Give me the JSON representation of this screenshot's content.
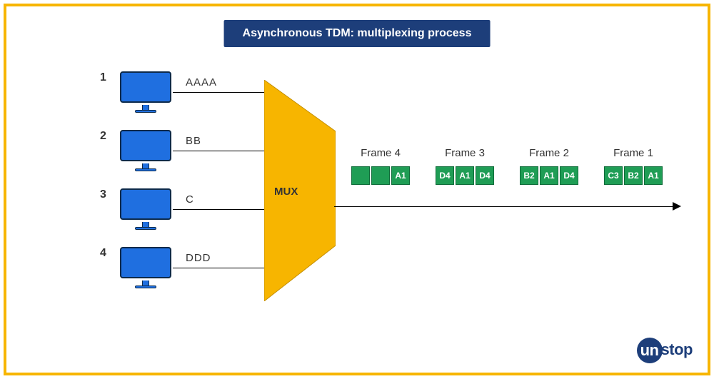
{
  "title": "Asynchronous TDM: multiplexing process",
  "inputs": [
    {
      "num": "1",
      "data": "AAAA"
    },
    {
      "num": "2",
      "data": "BB"
    },
    {
      "num": "3",
      "data": "C"
    },
    {
      "num": "4",
      "data": "DDD"
    }
  ],
  "mux_label": "MUX",
  "frames": [
    {
      "title": "Frame 4",
      "slots": [
        "",
        "",
        "A1"
      ]
    },
    {
      "title": "Frame 3",
      "slots": [
        "D4",
        "A1",
        "D4"
      ]
    },
    {
      "title": "Frame 2",
      "slots": [
        "B2",
        "A1",
        "D4"
      ]
    },
    {
      "title": "Frame 1",
      "slots": [
        "C3",
        "B2",
        "A1"
      ]
    }
  ],
  "logo": {
    "accent": "un",
    "rest": "stop"
  },
  "colors": {
    "border": "#f7b500",
    "title_bg": "#1d3e7a",
    "monitor": "#1f6fe0",
    "slot": "#1f9d55"
  }
}
